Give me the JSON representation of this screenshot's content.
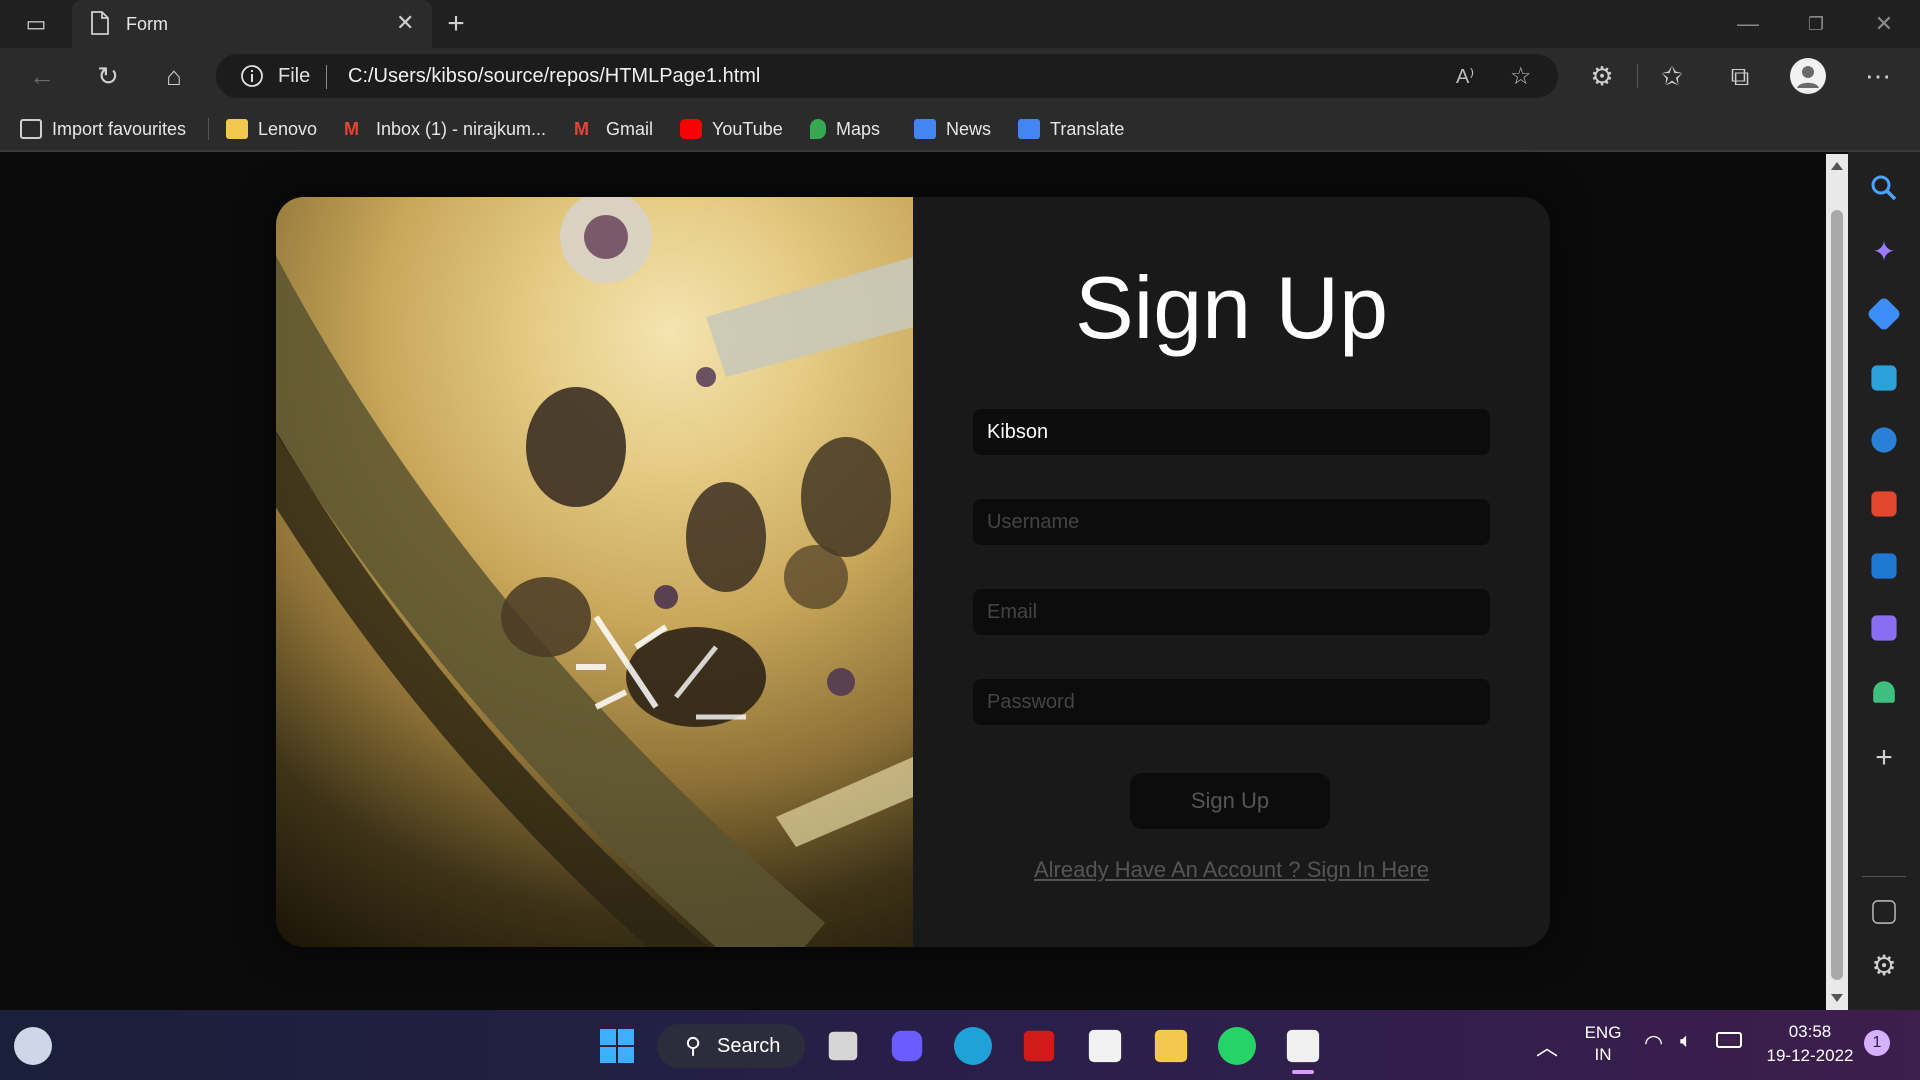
{
  "browser": {
    "tab_title": "Form",
    "address_scheme": "File",
    "address_url": "C:/Users/kibso/source/repos/HTMLPage1.html",
    "bookmarks": [
      {
        "label": "Import favourites",
        "icon": "import-icon",
        "color": "#cfcfcf"
      },
      {
        "label": "Lenovo",
        "icon": "folder-icon",
        "color": "#f2c94c"
      },
      {
        "label": "Inbox (1) - nirajkum...",
        "icon": "gmail-icon",
        "color": "#ea4335"
      },
      {
        "label": "Gmail",
        "icon": "gmail-icon",
        "color": "#ea4335"
      },
      {
        "label": "YouTube",
        "icon": "youtube-icon",
        "color": "#ff0000"
      },
      {
        "label": "Maps",
        "icon": "maps-icon",
        "color": "#34a853"
      },
      {
        "label": "News",
        "icon": "news-icon",
        "color": "#4285f4"
      },
      {
        "label": "Translate",
        "icon": "translate-icon",
        "color": "#4285f4"
      }
    ]
  },
  "form": {
    "heading": "Sign Up",
    "name_value": "Kibson",
    "username_placeholder": "Username",
    "email_placeholder": "Email",
    "password_placeholder": "Password",
    "submit_label": "Sign Up",
    "signin_link": "Already Have An Account ? Sign In Here"
  },
  "taskbar": {
    "search_label": "Search",
    "lang_line1": "ENG",
    "lang_line2": "IN",
    "time": "03:58",
    "date": "19-12-2022",
    "notification_count": "1"
  }
}
